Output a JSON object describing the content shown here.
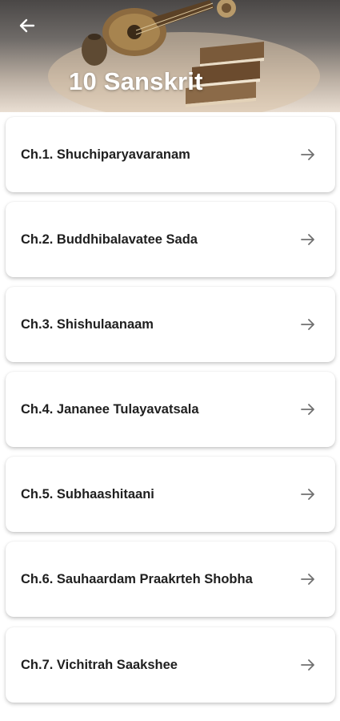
{
  "header": {
    "title": "10 Sanskrit",
    "back_icon": "arrow-left-icon",
    "art_icon": "sitar-and-books-illustration"
  },
  "chapters": [
    {
      "label": "Ch.1. Shuchiparyavaranam"
    },
    {
      "label": "Ch.2. Buddhibalavatee Sada"
    },
    {
      "label": "Ch.3. Shishulaanaam"
    },
    {
      "label": "Ch.4. Jananee Tulayavatsala"
    },
    {
      "label": "Ch.5. Subhaashitaani"
    },
    {
      "label": "Ch.6. Sauhaardam Praakrteh Shobha"
    },
    {
      "label": "Ch.7. Vichitrah Saakshee"
    }
  ],
  "colors": {
    "card_bg": "#ffffff",
    "text": "#1f1f1f",
    "arrow": "#707070",
    "title": "#ffffff"
  }
}
